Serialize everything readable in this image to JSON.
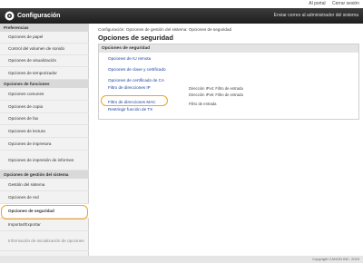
{
  "top_links": {
    "portal": "Al portal",
    "logout": "Cerrar sesión"
  },
  "header": {
    "title": "Configuración",
    "mail_admin": "Enviar correo al administrador del sistema"
  },
  "sidebar": {
    "preferences_head": "Preferencias",
    "preferences": [
      "Opciones de papel",
      "Control del volumen de sonido",
      "Opciones de visualización",
      "Opciones de temporizador"
    ],
    "functions_head": "Opciones de funciones",
    "functions": [
      "Opciones comunes",
      "Opciones de copia",
      "Opciones de fax",
      "Opciones de lectura",
      "Opciones de impresora",
      "Opciones de impresión de informes"
    ],
    "management_head": "Opciones de gestión del sistema",
    "management": [
      "Gestión del sistema",
      "Opciones de red",
      "Opciones de seguridad",
      "Importar/Exportar",
      "Información de inicialización de opciones"
    ]
  },
  "main": {
    "breadcrumb": "Configuración: Opciones de gestión del sistema: Opciones de seguridad",
    "title": "Opciones de seguridad",
    "box_title": "Opciones de seguridad",
    "items": [
      {
        "label": "Opciones de IU remota",
        "desc": ""
      },
      {
        "label": "Opciones de clave y certificado",
        "desc": ""
      },
      {
        "label": "Opciones de certificado de CA",
        "desc": ""
      },
      {
        "label": "Filtro de direcciones IP",
        "desc": "Dirección IPv4: Filtro de entrada",
        "desc2": "Dirección IPv6: Filtro de entrada"
      },
      {
        "label": "Filtro de direcciones MAC",
        "desc": "Filtro de entrada"
      },
      {
        "label": "Restringir función de TX",
        "desc": ""
      }
    ]
  },
  "footer": {
    "copyright": "Copyright CANON INC. 2015"
  },
  "colors": {
    "header": "#2b2b2b",
    "link": "#1a3fa0",
    "highlight": "#f5a31a"
  }
}
